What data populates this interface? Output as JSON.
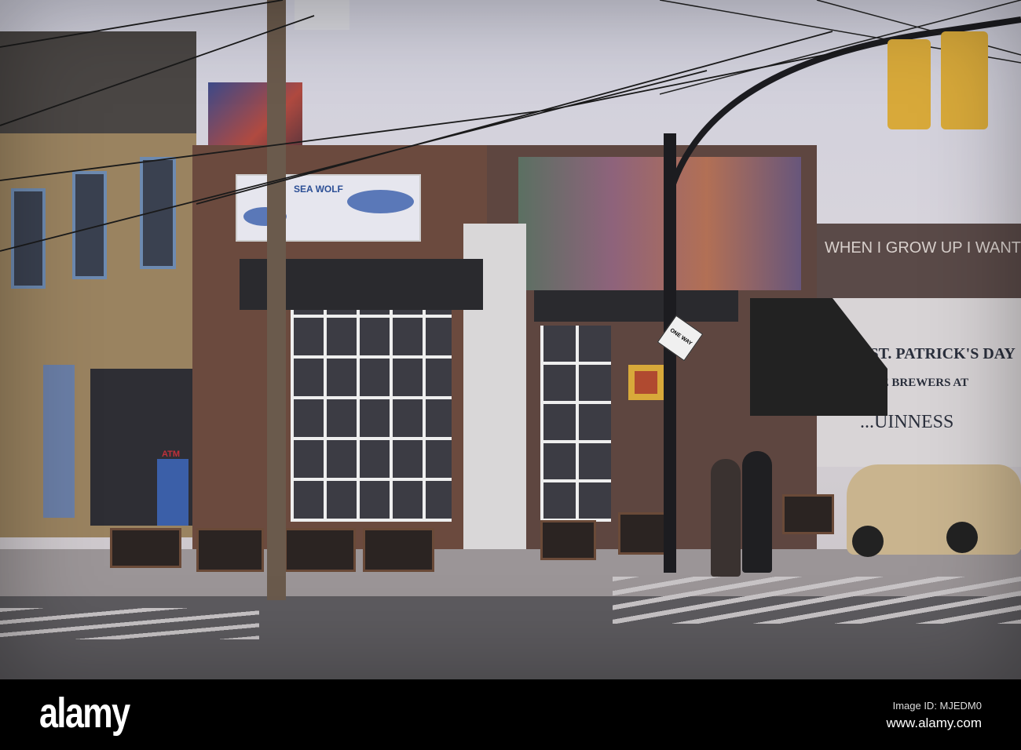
{
  "scene": {
    "restaurant_sign": "SEA WOLF",
    "atm_sign": "ATM",
    "one_way_sign": "ONE WAY",
    "rooftop_mural_text": "WHEN I GROW UP I WANT",
    "mural_line1": "...RY ST. PATRICK'S DAY",
    "mural_line2": "THE BREWERS AT",
    "mural_line3": "...UINNESS"
  },
  "watermark": {
    "logo": "alamy",
    "image_id": "Image ID: MJEDM0",
    "url": "www.alamy.com"
  },
  "colors": {
    "sky": "#d3d1dc",
    "brick": "#6b4a3e",
    "road": "#5b5a5e",
    "car": "#c9b48e",
    "traffic_light": "#d8a93a"
  }
}
